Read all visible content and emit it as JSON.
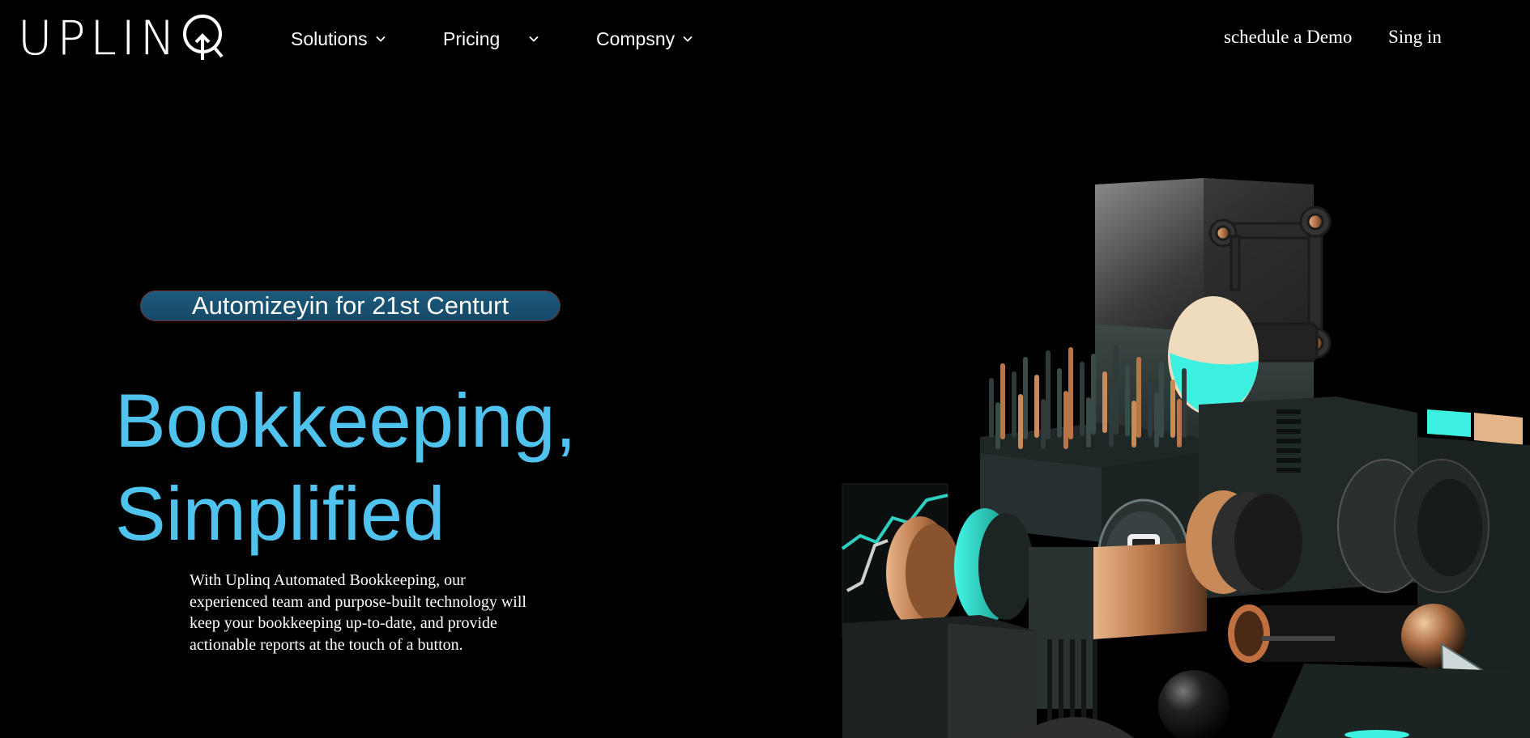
{
  "brand": {
    "logo_text": "UPLIN",
    "logo_label": "UPLINQ"
  },
  "nav": {
    "items": [
      {
        "label": "Solutions",
        "icon": "chevron-down-icon"
      },
      {
        "label": "Pricing",
        "icon": "chevron-down-icon"
      },
      {
        "label": "Compsny",
        "icon": "chevron-down-icon"
      }
    ],
    "schedule_demo": "schedule a Demo",
    "sign_in": "Sing in"
  },
  "hero": {
    "badge": "Automizeyin for 21st Centurt",
    "title_line1": "Bookkeeping,",
    "title_line2": "Simplified",
    "description": "With Uplinq Automated Bookkeeping, our experienced team and purpose-built technology will keep your bookkeeping up-to-date, and provide actionable reports at the touch of a button."
  },
  "theme": {
    "background": "#000000",
    "accent_blue": "#4fc3ee",
    "badge_bg": "#1d5a7c",
    "badge_border": "#7a2d2d",
    "teal": "#3ef0e0",
    "copper": "#c98a5a"
  }
}
